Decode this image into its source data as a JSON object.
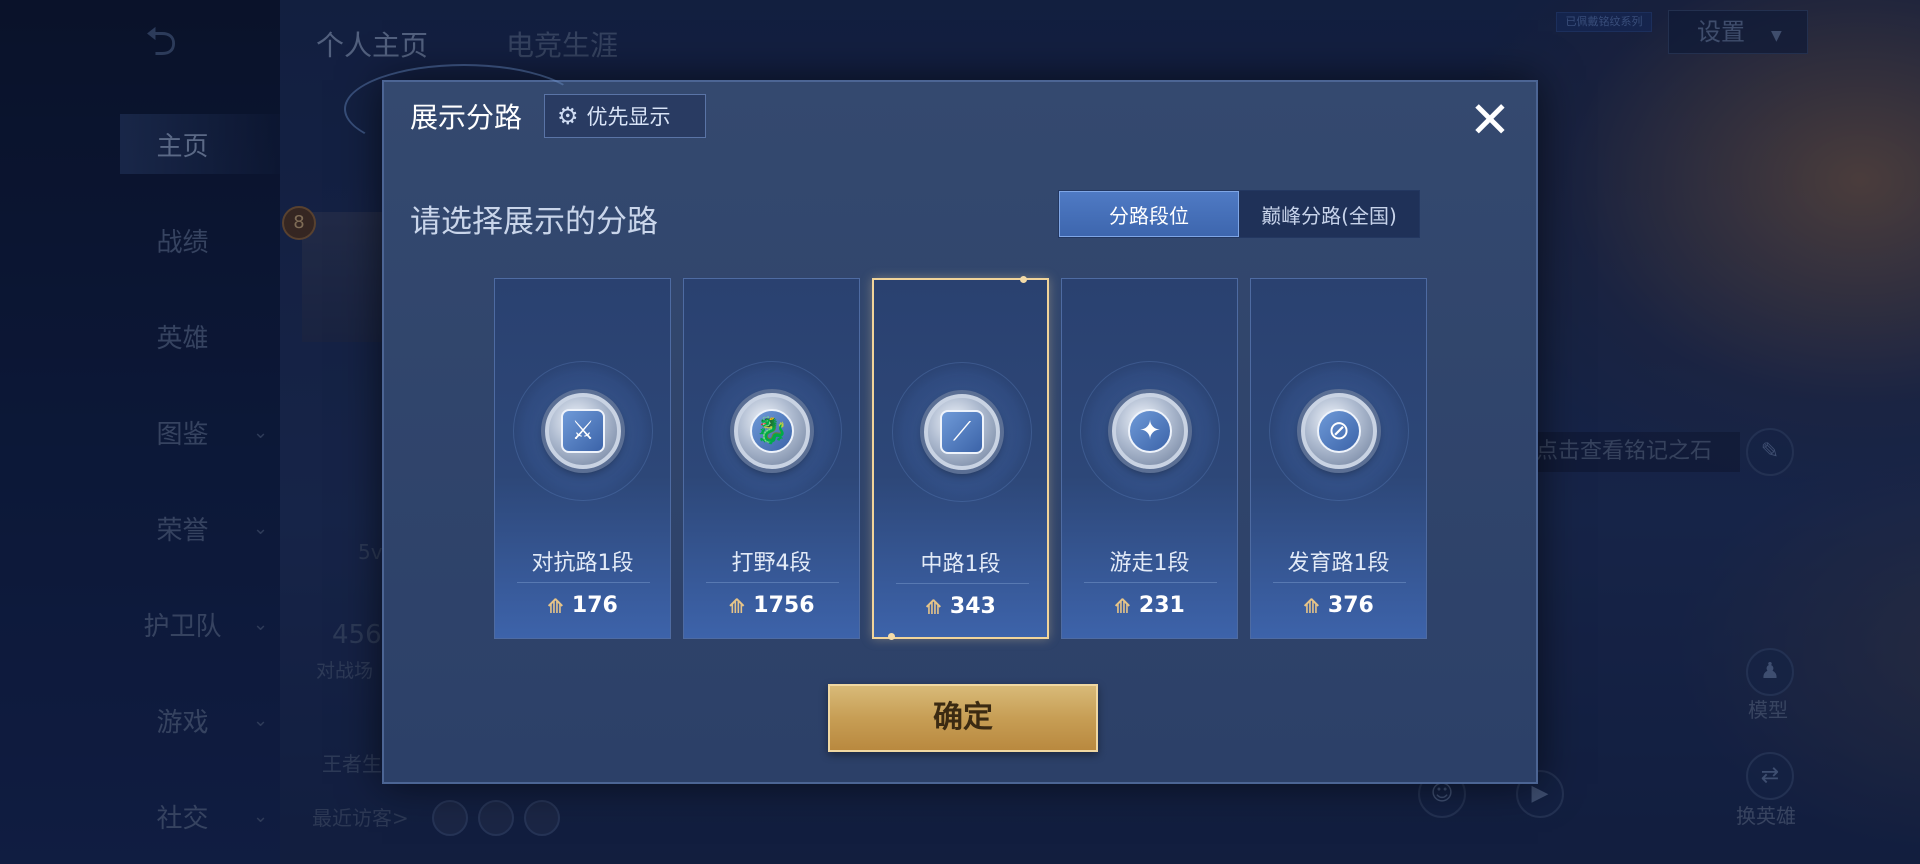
{
  "sidebar": {
    "back_icon": "back-arrow-icon",
    "items": [
      {
        "label": "主页",
        "expandable": false,
        "active": true
      },
      {
        "label": "战绩",
        "expandable": false
      },
      {
        "label": "英雄",
        "expandable": false
      },
      {
        "label": "图鉴",
        "expandable": true
      },
      {
        "label": "荣誉",
        "expandable": true
      },
      {
        "label": "护卫队",
        "expandable": true
      },
      {
        "label": "游戏",
        "expandable": true
      },
      {
        "label": "社交",
        "expandable": true
      }
    ]
  },
  "top_tabs": [
    "个人主页",
    "电竞生涯"
  ],
  "settings": {
    "label": "设置",
    "badge": "已佩戴铭纹系列"
  },
  "background": {
    "level": "8",
    "partial_text_1": "5v",
    "partial_number": "456",
    "partial_text_2": "对战场",
    "partial_text_3": "王者生",
    "hint": "点击查看铭记之石",
    "model_label": "模型",
    "swap_hero_label": "换英雄",
    "recent_visitors": "最近访客>"
  },
  "modal": {
    "title": "展示分路",
    "priority_button": "优先显示",
    "prompt": "请选择展示的分路",
    "segment": {
      "selected": "分路段位",
      "other": "巅峰分路(全国)"
    },
    "lanes": [
      {
        "name": "对抗路1段",
        "points": "176",
        "icon": "clash-lane-icon",
        "glyph": "⚔"
      },
      {
        "name": "打野4段",
        "points": "1756",
        "icon": "jungle-dragon-icon",
        "glyph": "🐉"
      },
      {
        "name": "中路1段",
        "points": "343",
        "icon": "mid-lane-icon",
        "glyph": "⟋",
        "selected": true
      },
      {
        "name": "游走1段",
        "points": "231",
        "icon": "roam-wings-icon",
        "glyph": "✦"
      },
      {
        "name": "发育路1段",
        "points": "376",
        "icon": "farm-lane-icon",
        "glyph": "⊘"
      }
    ],
    "confirm_button": "确定"
  },
  "colors": {
    "modal_bg": "#34496f",
    "accent_blue": "#4f7ac4",
    "selected_border": "#f1d49a",
    "confirm_gold": "#c79e55"
  }
}
